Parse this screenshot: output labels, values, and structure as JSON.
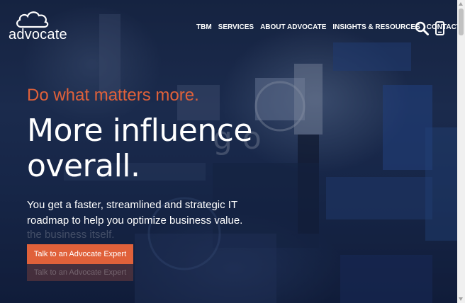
{
  "brand": {
    "logo_text": "advocate"
  },
  "nav": {
    "items": [
      {
        "label": "TBM"
      },
      {
        "label": "SERVICES"
      },
      {
        "label": "ABOUT ADVOCATE"
      },
      {
        "label": "INSIGHTS & RESOURCES"
      },
      {
        "label": "CONTACT"
      }
    ],
    "search_icon": "search-icon",
    "phone_icon": "phone-icon"
  },
  "hero": {
    "tagline": "Do what matters more.",
    "headline_line1": "More influence",
    "headline_line2": "overall.",
    "body": "You get a faster, streamlined and strategic IT roadmap to help you optimize business value.",
    "ghost_body_line": "the business itself.",
    "cta_label": "Talk to an Advocate Expert",
    "cta_ghost_label": "Talk to an Advocate Expert"
  },
  "colors": {
    "accent": "#e0613a",
    "background": "#1c2f55",
    "text": "#ffffff"
  }
}
